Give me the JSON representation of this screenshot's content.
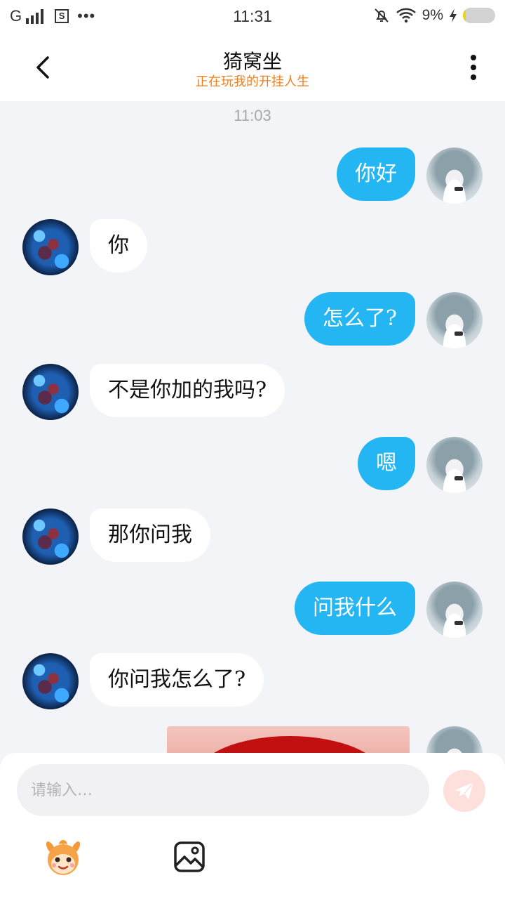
{
  "status_bar": {
    "carrier": "G",
    "time": "11:31",
    "battery": "9%",
    "battery_level": 0.09,
    "icons": [
      "signal-icon",
      "s-box-icon",
      "more-dots-icon",
      "mute-bell-icon",
      "wifi-icon",
      "charging-icon",
      "battery-icon"
    ]
  },
  "header": {
    "title": "猗窝坐",
    "subtitle": "正在玩我的开挂人生",
    "back_icon": "back-arrow-icon",
    "more_icon": "more-vertical-icon",
    "subtitle_color": "#f07f20"
  },
  "chat": {
    "timestamp": "11:03",
    "messages": [
      {
        "side": "out",
        "text": "你好"
      },
      {
        "side": "in",
        "text": "你"
      },
      {
        "side": "out",
        "text": "怎么了?"
      },
      {
        "side": "in",
        "text": "不是你加的我吗?"
      },
      {
        "side": "out",
        "text": "嗯"
      },
      {
        "side": "in",
        "text": "那你问我"
      },
      {
        "side": "out",
        "text": "问我什么"
      },
      {
        "side": "in",
        "text": "你问我怎么了?"
      },
      {
        "side": "out",
        "type": "image"
      }
    ],
    "outgoing_bubble_color": "#24b5f3",
    "incoming_bubble_color": "#ffffff"
  },
  "composer": {
    "placeholder": "请输入…",
    "value": "",
    "send_icon": "send-icon",
    "emoji_icon": "emoji-face-icon",
    "gallery_icon": "image-gallery-icon"
  }
}
